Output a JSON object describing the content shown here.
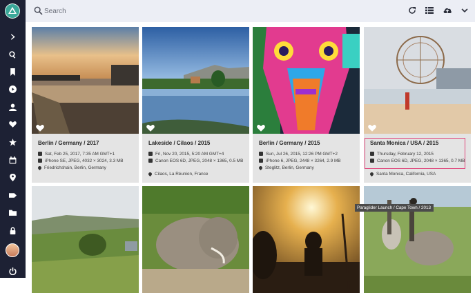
{
  "search": {
    "placeholder": "Search"
  },
  "sidebar": {
    "items": [
      "expand-icon",
      "search-icon",
      "bookmark-icon",
      "play-icon",
      "person-icon",
      "heart-icon",
      "star-icon",
      "calendar-icon",
      "location-icon",
      "label-icon",
      "folder-icon",
      "lock-icon",
      "avatar",
      "power-icon"
    ]
  },
  "toolbar": {
    "icons": [
      "refresh-icon",
      "list-view-icon",
      "upload-icon",
      "chevron-down-icon"
    ]
  },
  "cards": [
    {
      "title": "Berlin / Germany / 2017",
      "date": "Sat, Feb 25, 2017, 7:35 AM GMT+1",
      "camera": "iPhone SE, JPEG, 4032 × 3024, 3.3 MB",
      "location": "Friedrichshain, Berlin, Germany"
    },
    {
      "title": "Lakeside / Cilaos / 2015",
      "date": "Fri, Nov 20, 2015, 5:20 AM GMT+4",
      "camera": "Canon EOS 6D, JPEG, 2048 × 1365, 0.5 MB",
      "location": "Cilaos, La Réunion, France"
    },
    {
      "title": "Berlin / Germany / 2015",
      "date": "Sun, Jul 26, 2015, 12:26 PM GMT+2",
      "camera": "iPhone 6, JPEG, 2448 × 3264, 2.9 MB",
      "location": "Steglitz, Berlin, Germany"
    },
    {
      "title": "Santa Monica / USA / 2015",
      "date": "Thursday, February 12, 2015",
      "camera": "Canon EOS 6D, JPEG, 2048 × 1365, 0.7 MB",
      "location": "Santa Monica, California, USA"
    }
  ],
  "tooltip": {
    "text": "Paraglider Launch / Cape Town / 2013"
  },
  "colors": {
    "sidebar": "#1d2134",
    "topbar": "#eceef5",
    "card": "#e4e4e4",
    "highlight": "#e0457b"
  }
}
